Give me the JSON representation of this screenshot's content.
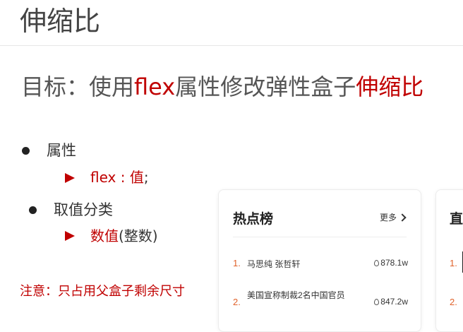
{
  "header": {
    "title": "伸缩比"
  },
  "goal": {
    "prefix": "目标：使用",
    "flex": "flex",
    "middle": "属性修改弹性盒子",
    "highlight": "伸缩比"
  },
  "points": [
    {
      "label": "属性",
      "sub": {
        "text": "flex : 值",
        "suffix": ";"
      }
    },
    {
      "label": "取值分类",
      "sub": {
        "text": "数值",
        "suffix": "(整数)"
      }
    }
  ],
  "note": "注意：只占用父盒子剩余尺寸",
  "hot_list": {
    "title": "热点榜",
    "more_label": "更多",
    "items": [
      {
        "rank": "1.",
        "text": "马思纯 张哲轩",
        "heat": "878.1w"
      },
      {
        "rank": "2.",
        "text": "美国宣称制裁2名中国官员",
        "heat": "847.2w"
      }
    ]
  },
  "second_card": {
    "title": "直",
    "ranks": [
      "1.",
      "2."
    ]
  },
  "colors": {
    "accent": "#c00000",
    "rank": "#e0622b"
  }
}
